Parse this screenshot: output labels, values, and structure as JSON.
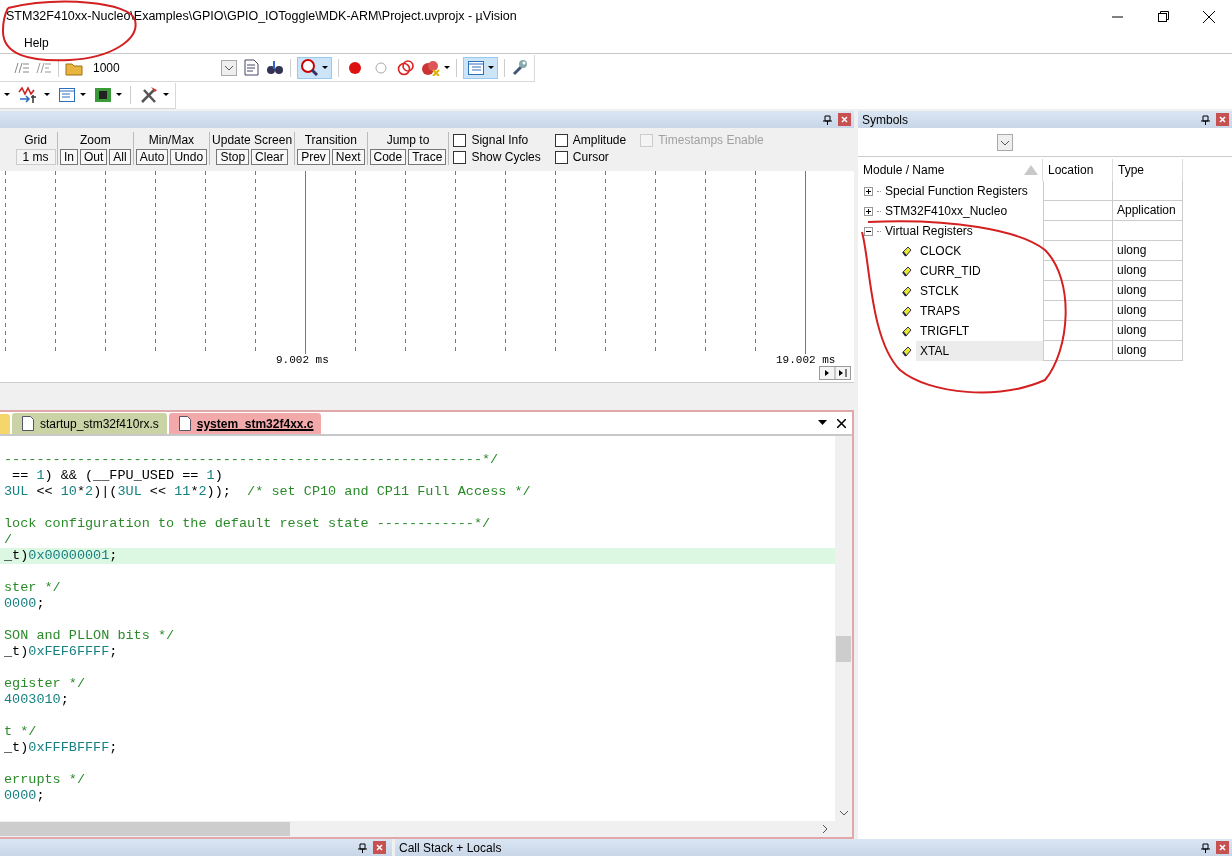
{
  "window": {
    "title": "STM32F410xx-Nucleo\\Examples\\GPIO\\GPIO_IOToggle\\MDK-ARM\\Project.uvprojx - µVision"
  },
  "menu": [
    {
      "label": "Help"
    }
  ],
  "toolbar": {
    "field_value": "1000"
  },
  "logic_analyzer": {
    "groups": [
      {
        "label": "Grid",
        "display": "1 ms"
      },
      {
        "label": "Zoom",
        "buttons": [
          "In",
          "Out",
          "All"
        ]
      },
      {
        "label": "Min/Max",
        "buttons": [
          "Auto",
          "Undo"
        ]
      },
      {
        "label": "Update Screen",
        "buttons": [
          "Stop",
          "Clear"
        ]
      },
      {
        "label": "Transition",
        "buttons": [
          "Prev",
          "Next"
        ]
      },
      {
        "label": "Jump to",
        "buttons": [
          "Code",
          "Trace"
        ]
      }
    ],
    "checkboxes": [
      {
        "label": "Signal Info",
        "checked": false,
        "disabled": false
      },
      {
        "label": "Show Cycles",
        "checked": false,
        "disabled": false
      },
      {
        "label": "Amplitude",
        "checked": false,
        "disabled": false
      },
      {
        "label": "Cursor",
        "checked": false,
        "disabled": false
      },
      {
        "label": "Timestamps Enable",
        "checked": false,
        "disabled": true
      }
    ],
    "time_labels": [
      "9.002 ms",
      "19.002 ms"
    ]
  },
  "editor": {
    "tabs": [
      {
        "label": "startup_stm32f410rx.s",
        "selected": false
      },
      {
        "label": "system_stm32f4xx.c",
        "selected": true
      }
    ],
    "blocks": [
      [
        {
          "highlighted": false,
          "segments": [
            {
              "t": "-----------------------------------------------------------*/",
              "kind": "comment"
            }
          ]
        },
        {
          "highlighted": false,
          "segments": [
            {
              "t": " == ",
              "kind": "plain"
            },
            {
              "t": "1",
              "kind": "number"
            },
            {
              "t": ") && (__FPU_USED == ",
              "kind": "plain"
            },
            {
              "t": "1",
              "kind": "number"
            },
            {
              "t": ")",
              "kind": "plain"
            }
          ]
        },
        {
          "highlighted": false,
          "segments": [
            {
              "t": "3UL",
              "kind": "number"
            },
            {
              "t": " << ",
              "kind": "plain"
            },
            {
              "t": "10",
              "kind": "number"
            },
            {
              "t": "*",
              "kind": "plain"
            },
            {
              "t": "2",
              "kind": "number"
            },
            {
              "t": ")|(",
              "kind": "plain"
            },
            {
              "t": "3UL",
              "kind": "number"
            },
            {
              "t": " << ",
              "kind": "plain"
            },
            {
              "t": "11",
              "kind": "number"
            },
            {
              "t": "*",
              "kind": "plain"
            },
            {
              "t": "2",
              "kind": "number"
            },
            {
              "t": "));  ",
              "kind": "plain"
            },
            {
              "t": "/* set CP10 and CP11 Full Access */",
              "kind": "comment"
            }
          ]
        }
      ],
      [
        {
          "highlighted": false,
          "segments": [
            {
              "t": "lock configuration to the default reset state ------------*/",
              "kind": "comment"
            }
          ]
        },
        {
          "highlighted": false,
          "segments": [
            {
              "t": "/",
              "kind": "comment"
            }
          ]
        },
        {
          "highlighted": true,
          "segments": [
            {
              "t": "_t)",
              "kind": "plain"
            },
            {
              "t": "0x00000001",
              "kind": "number"
            },
            {
              "t": ";",
              "kind": "plain"
            }
          ]
        }
      ],
      [
        {
          "highlighted": false,
          "segments": [
            {
              "t": "ster */",
              "kind": "comment"
            }
          ]
        },
        {
          "highlighted": false,
          "segments": [
            {
              "t": "0000",
              "kind": "number"
            },
            {
              "t": ";",
              "kind": "plain"
            }
          ]
        }
      ],
      [
        {
          "highlighted": false,
          "segments": [
            {
              "t": "SON and PLLON bits */",
              "kind": "comment"
            }
          ]
        },
        {
          "highlighted": false,
          "segments": [
            {
              "t": "_t)",
              "kind": "plain"
            },
            {
              "t": "0xFEF6FFFF",
              "kind": "number"
            },
            {
              "t": ";",
              "kind": "plain"
            }
          ]
        }
      ],
      [
        {
          "highlighted": false,
          "segments": [
            {
              "t": "egister */",
              "kind": "comment"
            }
          ]
        },
        {
          "highlighted": false,
          "segments": [
            {
              "t": "4003010",
              "kind": "number"
            },
            {
              "t": ";",
              "kind": "plain"
            }
          ]
        }
      ],
      [
        {
          "highlighted": false,
          "segments": [
            {
              "t": "t */",
              "kind": "comment"
            }
          ]
        },
        {
          "highlighted": false,
          "segments": [
            {
              "t": "_t)",
              "kind": "plain"
            },
            {
              "t": "0xFFFBFFFF",
              "kind": "number"
            },
            {
              "t": ";",
              "kind": "plain"
            }
          ]
        }
      ],
      [
        {
          "highlighted": false,
          "segments": [
            {
              "t": "errupts */",
              "kind": "comment"
            }
          ]
        },
        {
          "highlighted": false,
          "segments": [
            {
              "t": "0000",
              "kind": "number"
            },
            {
              "t": ";",
              "kind": "plain"
            }
          ]
        }
      ]
    ]
  },
  "symbols": {
    "title": "Symbols",
    "columns": [
      "Module / Name",
      "Location",
      "Type"
    ],
    "tree": [
      {
        "name": "Special Function Registers",
        "expanded": false,
        "selected": false
      },
      {
        "name": "STM32F410xx_Nucleo",
        "type": "Application",
        "expanded": false,
        "selected": false
      },
      {
        "name": "Virtual Registers",
        "expanded": true,
        "selected": false,
        "children": [
          {
            "name": "CLOCK",
            "type": "ulong",
            "selected": false
          },
          {
            "name": "CURR_TID",
            "type": "ulong",
            "selected": false
          },
          {
            "name": "STCLK",
            "type": "ulong",
            "selected": false
          },
          {
            "name": "TRAPS",
            "type": "ulong",
            "selected": false
          },
          {
            "name": "TRIGFLT",
            "type": "ulong",
            "selected": false
          },
          {
            "name": "XTAL",
            "type": "ulong",
            "selected": true
          }
        ]
      }
    ]
  },
  "bottom_panels": [
    {
      "title": "Call Stack + Locals"
    }
  ]
}
